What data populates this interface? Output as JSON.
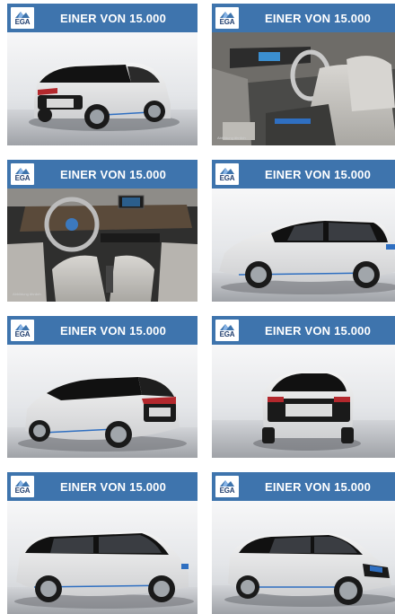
{
  "listing": {
    "tiles": [
      {
        "logo_text": "EGA",
        "banner_text": "EINER VON 15.000",
        "image_label": "rear-three-quarter-view"
      },
      {
        "logo_text": "EGA",
        "banner_text": "EINER VON 15.000",
        "image_label": "front-seats-interior",
        "watermark": "Abbildung ähnlich"
      },
      {
        "logo_text": "EGA",
        "banner_text": "EINER VON 15.000",
        "image_label": "dashboard-interior",
        "watermark": "Abbildung ähnlich"
      },
      {
        "logo_text": "EGA",
        "banner_text": "EINER VON 15.000",
        "image_label": "side-view"
      },
      {
        "logo_text": "EGA",
        "banner_text": "EINER VON 15.000",
        "image_label": "rear-three-quarter-view-2"
      },
      {
        "logo_text": "EGA",
        "banner_text": "EINER VON 15.000",
        "image_label": "rear-view"
      },
      {
        "logo_text": "EGA",
        "banner_text": "EINER VON 15.000",
        "image_label": "side-profile-view"
      },
      {
        "logo_text": "EGA",
        "banner_text": "EINER VON 15.000",
        "image_label": "front-three-quarter-view"
      }
    ]
  },
  "colors": {
    "banner": "#3e74ad",
    "banner_text": "#ffffff",
    "car_body": "#e6e6e6",
    "car_roof": "#111111",
    "accent": "#2f6fc1"
  }
}
